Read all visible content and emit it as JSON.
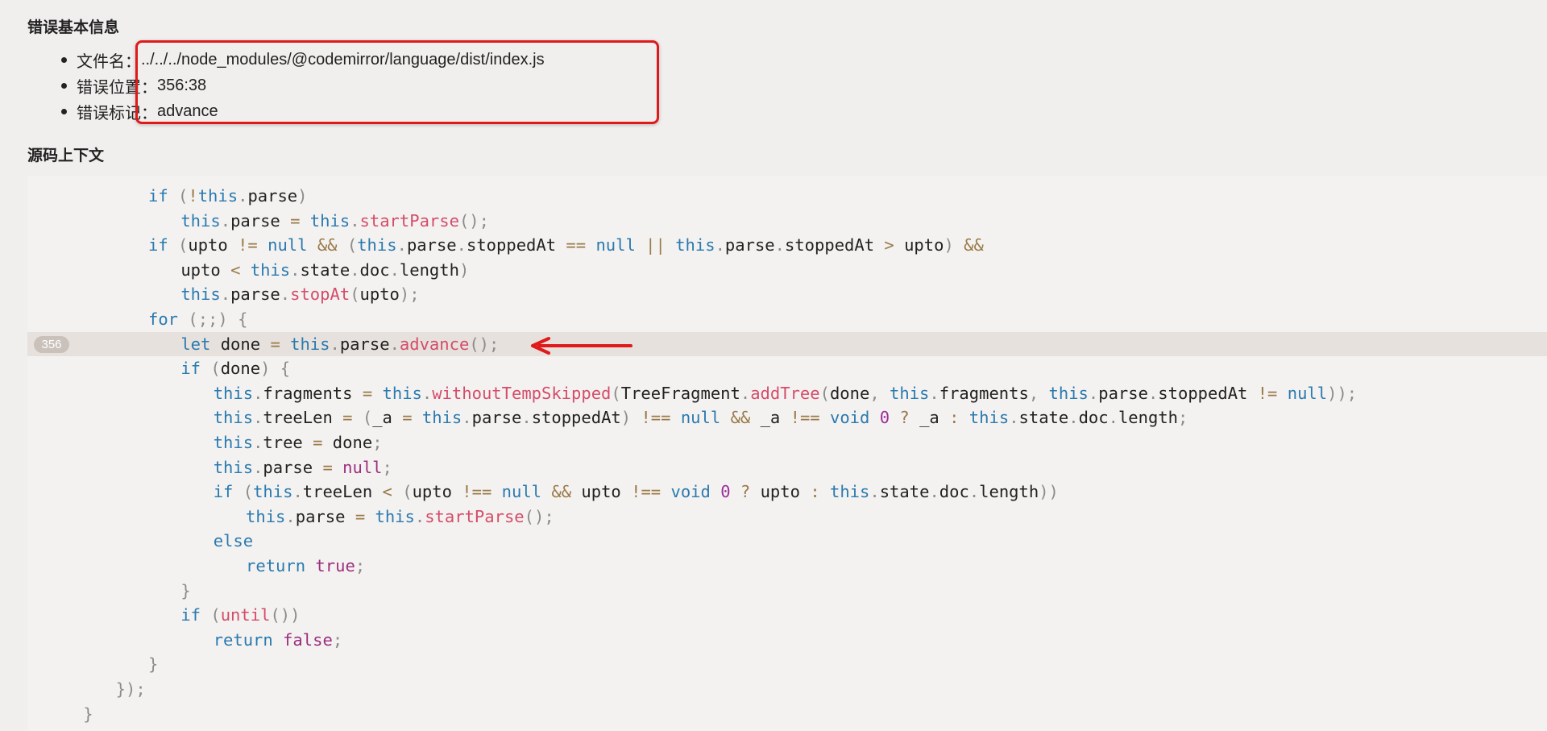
{
  "sections": {
    "basic_info_title": "错误基本信息",
    "context_title": "源码上下文"
  },
  "info": [
    {
      "label": "文件名：",
      "value": "../../../node_modules/@codemirror/language/dist/index.js"
    },
    {
      "label": "错误位置：",
      "value": "356:38"
    },
    {
      "label": "错误标记：",
      "value": "advance"
    }
  ],
  "highlighted_line_number": "356",
  "colors": {
    "keyword": "#2a7ab0",
    "function": "#d44c6a",
    "operator": "#9a7a4a",
    "annotation_red": "#e0191b",
    "highlight_row": "#e6e1dc"
  },
  "code_lines": [
    {
      "indent": 12,
      "tokens": [
        [
          "kw",
          "if"
        ],
        [
          "pn",
          " ("
        ],
        [
          "op",
          "!"
        ],
        [
          "kw",
          "this"
        ],
        [
          "pn",
          "."
        ],
        [
          "",
          "parse"
        ],
        [
          "pn",
          ")"
        ]
      ]
    },
    {
      "indent": 16,
      "tokens": [
        [
          "kw",
          "this"
        ],
        [
          "pn",
          "."
        ],
        [
          "",
          "parse "
        ],
        [
          "op",
          "="
        ],
        [
          "kw",
          " this"
        ],
        [
          "pn",
          "."
        ],
        [
          "fn",
          "startParse"
        ],
        [
          "pn",
          "();"
        ]
      ]
    },
    {
      "indent": 12,
      "tokens": [
        [
          "kw",
          "if"
        ],
        [
          "pn",
          " ("
        ],
        [
          "",
          "upto "
        ],
        [
          "op",
          "!="
        ],
        [
          "kw",
          " null "
        ],
        [
          "op",
          "&&"
        ],
        [
          "pn",
          " ("
        ],
        [
          "kw",
          "this"
        ],
        [
          "pn",
          "."
        ],
        [
          "",
          "parse"
        ],
        [
          "pn",
          "."
        ],
        [
          "",
          "stoppedAt "
        ],
        [
          "op",
          "=="
        ],
        [
          "kw",
          " null "
        ],
        [
          "op",
          "||"
        ],
        [
          "kw",
          " this"
        ],
        [
          "pn",
          "."
        ],
        [
          "",
          "parse"
        ],
        [
          "pn",
          "."
        ],
        [
          "",
          "stoppedAt "
        ],
        [
          "op",
          ">"
        ],
        [
          "",
          "",
          " upto"
        ],
        [
          "pn",
          ")"
        ],
        [
          "op",
          " &&"
        ]
      ]
    },
    {
      "indent": 16,
      "tokens": [
        [
          "",
          "upto "
        ],
        [
          "op",
          "<"
        ],
        [
          "kw",
          " this"
        ],
        [
          "pn",
          "."
        ],
        [
          "",
          "state"
        ],
        [
          "pn",
          "."
        ],
        [
          "",
          "doc"
        ],
        [
          "pn",
          "."
        ],
        [
          "",
          "length"
        ],
        [
          "pn",
          ")"
        ]
      ]
    },
    {
      "indent": 16,
      "tokens": [
        [
          "kw",
          "this"
        ],
        [
          "pn",
          "."
        ],
        [
          "",
          "parse"
        ],
        [
          "pn",
          "."
        ],
        [
          "fn",
          "stopAt"
        ],
        [
          "pn",
          "("
        ],
        [
          "",
          "upto"
        ],
        [
          "pn",
          ");"
        ]
      ]
    },
    {
      "indent": 12,
      "tokens": [
        [
          "kw",
          "for"
        ],
        [
          "pn",
          " (;;) {"
        ]
      ]
    },
    {
      "indent": 16,
      "active": true,
      "tokens": [
        [
          "kw",
          "let"
        ],
        [
          "",
          " done "
        ],
        [
          "op",
          "="
        ],
        [
          "kw",
          " this"
        ],
        [
          "pn",
          "."
        ],
        [
          "",
          "parse"
        ],
        [
          "pn",
          "."
        ],
        [
          "fn",
          "advance"
        ],
        [
          "pn",
          "();"
        ]
      ]
    },
    {
      "indent": 16,
      "tokens": [
        [
          "kw",
          "if"
        ],
        [
          "pn",
          " ("
        ],
        [
          "",
          "done"
        ],
        [
          "pn",
          ") {"
        ]
      ]
    },
    {
      "indent": 20,
      "tokens": [
        [
          "kw",
          "this"
        ],
        [
          "pn",
          "."
        ],
        [
          "",
          "fragments "
        ],
        [
          "op",
          "="
        ],
        [
          "kw",
          " this"
        ],
        [
          "pn",
          "."
        ],
        [
          "fn",
          "withoutTempSkipped"
        ],
        [
          "pn",
          "("
        ],
        [
          "",
          "TreeFragment"
        ],
        [
          "pn",
          "."
        ],
        [
          "fn",
          "addTree"
        ],
        [
          "pn",
          "("
        ],
        [
          "",
          "done"
        ],
        [
          "pn",
          ", "
        ],
        [
          "kw",
          "this"
        ],
        [
          "pn",
          "."
        ],
        [
          "",
          "fragments"
        ],
        [
          "pn",
          ", "
        ],
        [
          "kw",
          "this"
        ],
        [
          "pn",
          "."
        ],
        [
          "",
          "parse"
        ],
        [
          "pn",
          "."
        ],
        [
          "",
          "stoppedAt "
        ],
        [
          "op",
          "!="
        ],
        [
          "kw",
          " null"
        ],
        [
          "pn",
          "));"
        ]
      ]
    },
    {
      "indent": 20,
      "tokens": [
        [
          "kw",
          "this"
        ],
        [
          "pn",
          "."
        ],
        [
          "",
          "treeLen "
        ],
        [
          "op",
          "="
        ],
        [
          "pn",
          " ("
        ],
        [
          "",
          "_a "
        ],
        [
          "op",
          "="
        ],
        [
          "kw",
          " this"
        ],
        [
          "pn",
          "."
        ],
        [
          "",
          "parse"
        ],
        [
          "pn",
          "."
        ],
        [
          "",
          "stoppedAt"
        ],
        [
          "pn",
          ")"
        ],
        [
          "op",
          " !=="
        ],
        [
          "kw",
          " null "
        ],
        [
          "op",
          "&&"
        ],
        [
          "",
          " _a "
        ],
        [
          "op",
          "!=="
        ],
        [
          "kw",
          " void "
        ],
        [
          "num",
          "0"
        ],
        [
          "op",
          " ?"
        ],
        [
          "",
          " _a "
        ],
        [
          "op",
          ":"
        ],
        [
          "kw",
          " this"
        ],
        [
          "pn",
          "."
        ],
        [
          "",
          "state"
        ],
        [
          "pn",
          "."
        ],
        [
          "",
          "doc"
        ],
        [
          "pn",
          "."
        ],
        [
          "",
          "length"
        ],
        [
          "pn",
          ";"
        ]
      ]
    },
    {
      "indent": 20,
      "tokens": [
        [
          "kw",
          "this"
        ],
        [
          "pn",
          "."
        ],
        [
          "",
          "tree "
        ],
        [
          "op",
          "="
        ],
        [
          "",
          " done"
        ],
        [
          "pn",
          ";"
        ]
      ]
    },
    {
      "indent": 20,
      "tokens": [
        [
          "kw",
          "this"
        ],
        [
          "pn",
          "."
        ],
        [
          "",
          "parse "
        ],
        [
          "op",
          "="
        ],
        [
          "lit",
          " null"
        ],
        [
          "pn",
          ";"
        ]
      ]
    },
    {
      "indent": 20,
      "tokens": [
        [
          "kw",
          "if"
        ],
        [
          "pn",
          " ("
        ],
        [
          "kw",
          "this"
        ],
        [
          "pn",
          "."
        ],
        [
          "",
          "treeLen "
        ],
        [
          "op",
          "<"
        ],
        [
          "pn",
          " ("
        ],
        [
          "",
          "upto "
        ],
        [
          "op",
          "!=="
        ],
        [
          "kw",
          " null "
        ],
        [
          "op",
          "&&"
        ],
        [
          "",
          " upto "
        ],
        [
          "op",
          "!=="
        ],
        [
          "kw",
          " void "
        ],
        [
          "num",
          "0"
        ],
        [
          "op",
          " ?"
        ],
        [
          "",
          " upto "
        ],
        [
          "op",
          ":"
        ],
        [
          "kw",
          " this"
        ],
        [
          "pn",
          "."
        ],
        [
          "",
          "state"
        ],
        [
          "pn",
          "."
        ],
        [
          "",
          "doc"
        ],
        [
          "pn",
          "."
        ],
        [
          "",
          "length"
        ],
        [
          "pn",
          "))"
        ]
      ]
    },
    {
      "indent": 24,
      "tokens": [
        [
          "kw",
          "this"
        ],
        [
          "pn",
          "."
        ],
        [
          "",
          "parse "
        ],
        [
          "op",
          "="
        ],
        [
          "kw",
          " this"
        ],
        [
          "pn",
          "."
        ],
        [
          "fn",
          "startParse"
        ],
        [
          "pn",
          "();"
        ]
      ]
    },
    {
      "indent": 20,
      "tokens": [
        [
          "kw",
          "else"
        ]
      ]
    },
    {
      "indent": 24,
      "tokens": [
        [
          "kw",
          "return"
        ],
        [
          "lit",
          " true"
        ],
        [
          "pn",
          ";"
        ]
      ]
    },
    {
      "indent": 16,
      "tokens": [
        [
          "pn",
          "}"
        ]
      ]
    },
    {
      "indent": 16,
      "tokens": [
        [
          "kw",
          "if"
        ],
        [
          "pn",
          " ("
        ],
        [
          "fn",
          "until"
        ],
        [
          "pn",
          "())"
        ]
      ]
    },
    {
      "indent": 20,
      "tokens": [
        [
          "kw",
          "return"
        ],
        [
          "lit",
          " false"
        ],
        [
          "pn",
          ";"
        ]
      ]
    },
    {
      "indent": 12,
      "tokens": [
        [
          "pn",
          "}"
        ]
      ]
    },
    {
      "indent": 8,
      "tokens": [
        [
          "pn",
          "});"
        ]
      ]
    },
    {
      "indent": 4,
      "tokens": [
        [
          "pn",
          "}"
        ]
      ]
    }
  ]
}
